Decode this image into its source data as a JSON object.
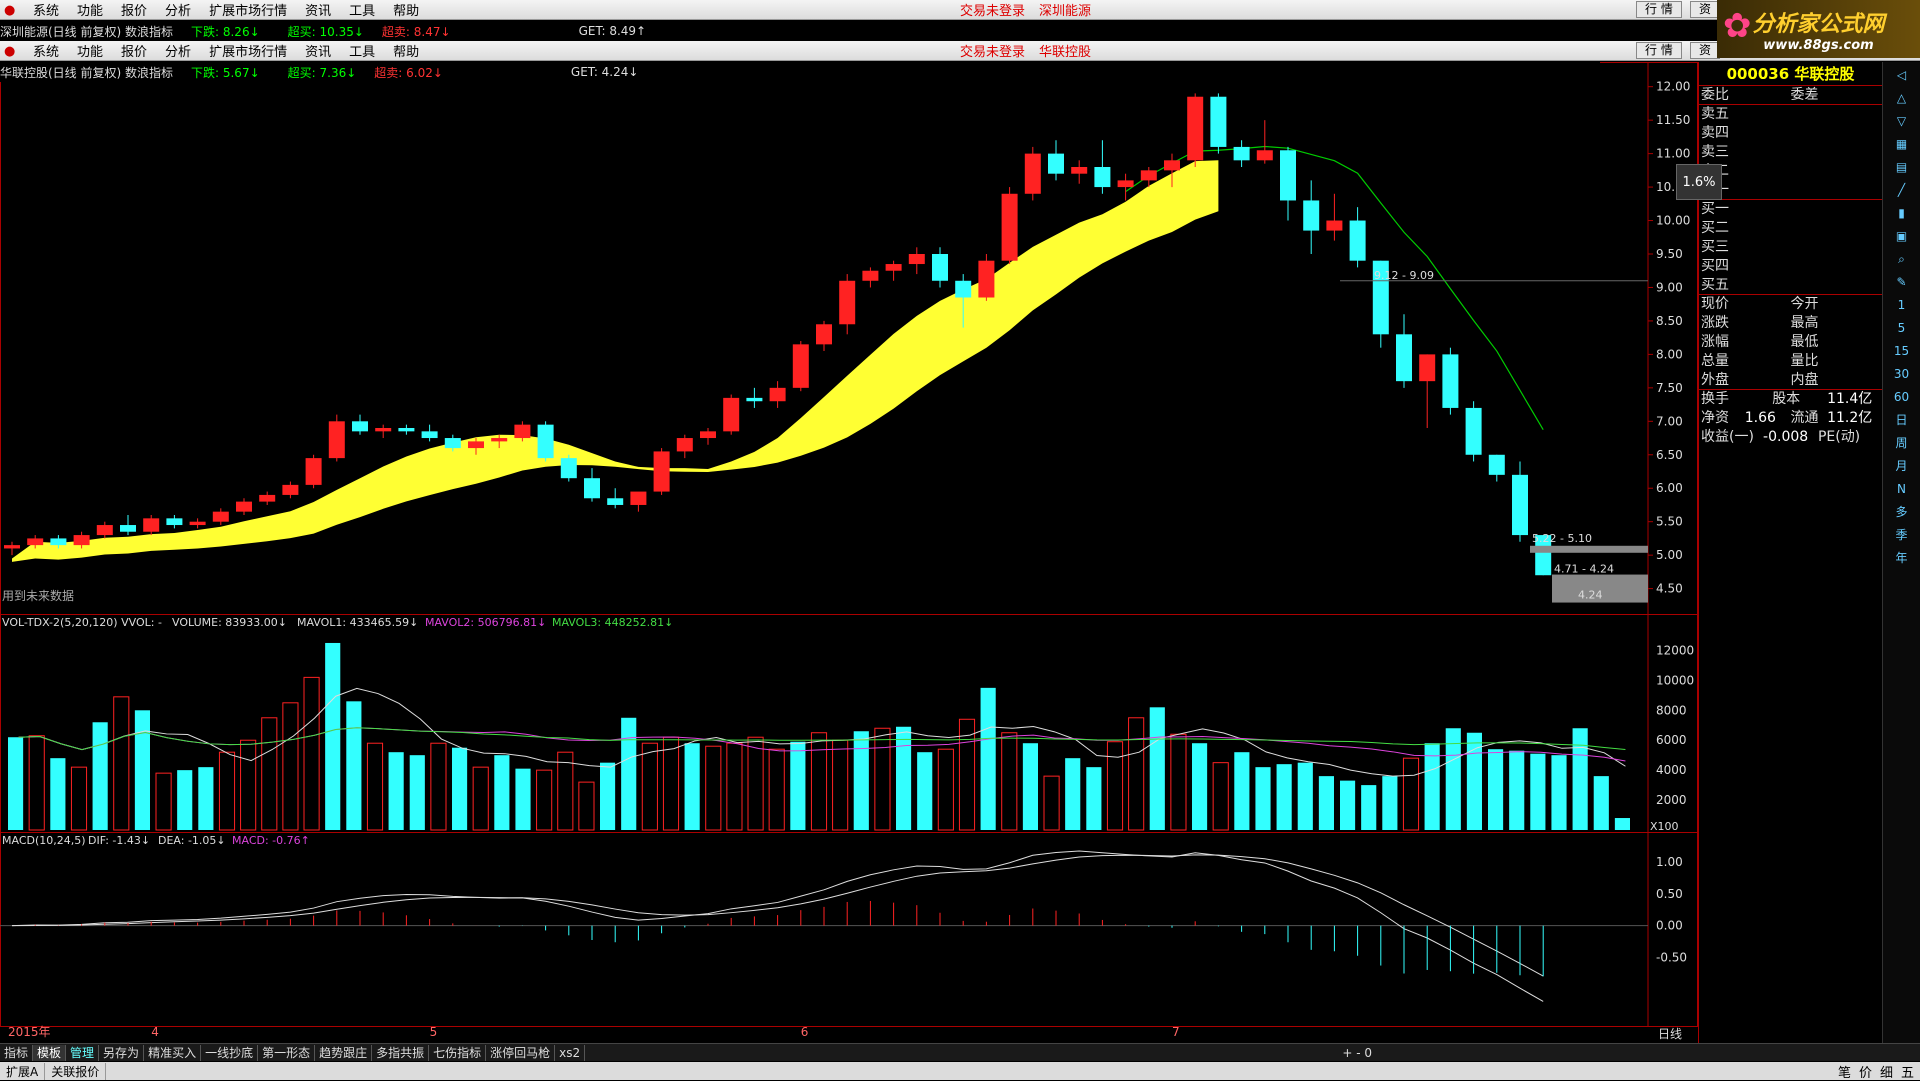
{
  "top_window": {
    "menu": [
      "系统",
      "功能",
      "报价",
      "分析",
      "扩展市场行情",
      "资讯",
      "工具",
      "帮助"
    ],
    "status_text": "交易未登录",
    "stock_name": "深圳能源",
    "buttons": [
      "行 情",
      "资"
    ],
    "info": {
      "title": "深圳能源(日线 前复权) 数浪指标",
      "down": "下跌: 8.26↓",
      "overbuy": "超买: 10.35↓",
      "oversell": "超卖: 8.47↓",
      "get": "GET: 8.49↑"
    }
  },
  "main_window": {
    "menu": [
      "系统",
      "功能",
      "报价",
      "分析",
      "扩展市场行情",
      "资讯",
      "工具",
      "帮助"
    ],
    "status_text": "交易未登录",
    "stock_name": "华联控股",
    "buttons": [
      "行 情",
      "资"
    ],
    "info": {
      "title": "华联控股(日线 前复权) 数浪指标",
      "down": "下跌: 5.67↓",
      "overbuy": "超买: 7.36↓",
      "oversell": "超卖: 6.02↓",
      "get": "GET: 4.24↓"
    }
  },
  "brand": {
    "name": "分析家公式网",
    "url": "www.88gs.com"
  },
  "percent_badge": "1.6%",
  "right_panel": {
    "code_title": "000036 华联控股",
    "order_header": [
      "委比",
      "委差"
    ],
    "sells": [
      "卖五",
      "卖四",
      "卖三",
      "卖二",
      "卖一"
    ],
    "buys": [
      "买一",
      "买二",
      "买三",
      "买四",
      "买五"
    ],
    "quote_rows": [
      [
        "现价",
        "今开"
      ],
      [
        "涨跌",
        "最高"
      ],
      [
        "涨幅",
        "最低"
      ],
      [
        "总量",
        "量比"
      ],
      [
        "外盘",
        "内盘"
      ]
    ],
    "fund_rows": [
      [
        "换手",
        "股本",
        "11.4亿"
      ],
      [
        "净资",
        "1.66",
        "流通",
        "11.2亿"
      ],
      [
        "收益(一)",
        "-0.008",
        "PE(动)"
      ]
    ]
  },
  "chart_labels": {
    "future_data": "用到未来数据",
    "range1": "9.12 - 9.09",
    "range2": "5.22 - 5.10",
    "range3": "4.71 - 4.24",
    "range4": "4.24",
    "vol_legend": "VOL-TDX-2(5,20,120) VVOL: -",
    "vol_volume": "VOLUME: 83933.00↓",
    "vol_mavol1": "MAVOL1: 433465.59↓",
    "vol_mavol2": "MAVOL2: 506796.81↓",
    "vol_mavol3": "MAVOL3: 448252.81↓",
    "vol_unit": "X100",
    "macd_legend": "MACD(10,24,5)",
    "macd_dif": "DIF: -1.43↓",
    "macd_dea": "DEA: -1.05↓",
    "macd_macd": "MACD: -0.76↑",
    "period": "日线"
  },
  "chart_data": {
    "type": "candlestick",
    "price_axis": [
      "12.00",
      "11.50",
      "11.00",
      "10.50",
      "10.00",
      "9.50",
      "9.00",
      "8.50",
      "8.00",
      "7.50",
      "7.00",
      "6.50",
      "6.00",
      "5.50",
      "5.00",
      "4.50"
    ],
    "volume_axis": [
      "12000",
      "10000",
      "8000",
      "6000",
      "4000",
      "2000"
    ],
    "macd_axis": [
      "1.00",
      "0.50",
      "0.00",
      "-0.50"
    ],
    "months": [
      "2015年",
      "4",
      "5",
      "6",
      "7"
    ],
    "candles": [
      [
        5.1,
        5.2,
        5.0,
        5.15
      ],
      [
        5.15,
        5.3,
        5.1,
        5.25
      ],
      [
        5.25,
        5.3,
        5.1,
        5.15
      ],
      [
        5.15,
        5.35,
        5.1,
        5.3
      ],
      [
        5.3,
        5.5,
        5.25,
        5.45
      ],
      [
        5.45,
        5.6,
        5.3,
        5.35
      ],
      [
        5.35,
        5.6,
        5.3,
        5.55
      ],
      [
        5.55,
        5.6,
        5.4,
        5.45
      ],
      [
        5.45,
        5.55,
        5.4,
        5.5
      ],
      [
        5.5,
        5.7,
        5.45,
        5.65
      ],
      [
        5.65,
        5.85,
        5.6,
        5.8
      ],
      [
        5.8,
        5.95,
        5.75,
        5.9
      ],
      [
        5.9,
        6.1,
        5.85,
        6.05
      ],
      [
        6.05,
        6.5,
        6.0,
        6.45
      ],
      [
        6.45,
        7.1,
        6.4,
        7.0
      ],
      [
        7.0,
        7.1,
        6.8,
        6.85
      ],
      [
        6.85,
        6.95,
        6.75,
        6.9
      ],
      [
        6.9,
        6.95,
        6.8,
        6.85
      ],
      [
        6.85,
        6.95,
        6.7,
        6.75
      ],
      [
        6.75,
        6.8,
        6.55,
        6.6
      ],
      [
        6.6,
        6.75,
        6.5,
        6.7
      ],
      [
        6.7,
        6.8,
        6.6,
        6.75
      ],
      [
        6.75,
        7.0,
        6.7,
        6.95
      ],
      [
        6.95,
        7.0,
        6.4,
        6.45
      ],
      [
        6.45,
        6.5,
        6.1,
        6.15
      ],
      [
        6.15,
        6.3,
        5.8,
        5.85
      ],
      [
        5.85,
        6.0,
        5.7,
        5.75
      ],
      [
        5.75,
        5.9,
        5.65,
        5.95
      ],
      [
        5.95,
        6.6,
        5.9,
        6.55
      ],
      [
        6.55,
        6.8,
        6.45,
        6.75
      ],
      [
        6.75,
        6.9,
        6.65,
        6.85
      ],
      [
        6.85,
        7.4,
        6.8,
        7.35
      ],
      [
        7.35,
        7.5,
        7.2,
        7.3
      ],
      [
        7.3,
        7.6,
        7.2,
        7.5
      ],
      [
        7.5,
        8.2,
        7.45,
        8.15
      ],
      [
        8.15,
        8.5,
        8.05,
        8.45
      ],
      [
        8.45,
        9.2,
        8.3,
        9.1
      ],
      [
        9.1,
        9.3,
        9.0,
        9.25
      ],
      [
        9.25,
        9.4,
        9.1,
        9.35
      ],
      [
        9.35,
        9.6,
        9.2,
        9.5
      ],
      [
        9.5,
        9.6,
        9.0,
        9.1
      ],
      [
        9.1,
        9.2,
        8.4,
        8.85
      ],
      [
        8.85,
        9.5,
        8.8,
        9.4
      ],
      [
        9.4,
        10.5,
        9.35,
        10.4
      ],
      [
        10.4,
        11.1,
        10.3,
        11.0
      ],
      [
        11.0,
        11.2,
        10.6,
        10.7
      ],
      [
        10.7,
        10.9,
        10.55,
        10.8
      ],
      [
        10.8,
        11.2,
        10.4,
        10.5
      ],
      [
        10.5,
        10.7,
        10.3,
        10.6
      ],
      [
        10.6,
        10.8,
        10.5,
        10.75
      ],
      [
        10.75,
        11.0,
        10.5,
        10.9
      ],
      [
        10.9,
        11.9,
        10.8,
        11.85
      ],
      [
        11.85,
        11.9,
        11.0,
        11.1
      ],
      [
        11.1,
        11.2,
        10.8,
        10.9
      ],
      [
        10.9,
        11.5,
        10.85,
        11.05
      ],
      [
        11.05,
        11.1,
        10.0,
        10.3
      ],
      [
        10.3,
        10.6,
        9.5,
        9.85
      ],
      [
        9.85,
        10.4,
        9.7,
        10.0
      ],
      [
        10.0,
        10.2,
        9.3,
        9.4
      ],
      [
        9.4,
        9.4,
        8.1,
        8.3
      ],
      [
        8.3,
        8.6,
        7.5,
        7.6
      ],
      [
        7.6,
        8.0,
        6.9,
        8.0
      ],
      [
        8.0,
        8.1,
        7.1,
        7.2
      ],
      [
        7.2,
        7.3,
        6.4,
        6.5
      ],
      [
        6.5,
        6.5,
        6.1,
        6.2
      ],
      [
        6.2,
        6.4,
        5.2,
        5.3
      ],
      [
        5.3,
        5.3,
        4.7,
        4.7
      ]
    ],
    "volumes": [
      6200,
      6300,
      4800,
      4200,
      7200,
      8900,
      8000,
      3800,
      4000,
      4200,
      5200,
      6000,
      7500,
      8500,
      10200,
      12500,
      8600,
      5800,
      5200,
      5000,
      5800,
      5500,
      4200,
      5000,
      4100,
      4000,
      5200,
      3200,
      4500,
      7500,
      5800,
      6200,
      5800,
      5600,
      5800,
      6200,
      5400,
      5900,
      6500,
      6000,
      6600,
      6800,
      6900,
      5200,
      5400,
      7400,
      9500,
      6500,
      5800,
      3600,
      4800,
      4200,
      5900,
      7500,
      8200,
      6400,
      5800,
      4500,
      5200,
      4200,
      4400,
      4500,
      3600,
      3300,
      3000,
      3600,
      4800,
      5800,
      6800,
      6500,
      5400,
      5300,
      5100,
      5000,
      6800,
      3600,
      800
    ],
    "volume_colors": [
      "down",
      "up",
      "down",
      "up",
      "down",
      "up",
      "down",
      "up",
      "down",
      "down",
      "up",
      "up",
      "up",
      "up",
      "up",
      "down",
      "down",
      "up",
      "down",
      "down",
      "up",
      "down",
      "up",
      "down",
      "down",
      "up",
      "up",
      "up",
      "down",
      "down",
      "up",
      "up",
      "down",
      "up",
      "up",
      "up",
      "up",
      "down",
      "up",
      "up",
      "down",
      "up",
      "down",
      "down",
      "up",
      "up",
      "down",
      "up",
      "down",
      "up",
      "down",
      "down",
      "up",
      "up",
      "down",
      "up",
      "down",
      "up",
      "down",
      "down",
      "down",
      "down",
      "down",
      "down",
      "down",
      "down",
      "up",
      "down",
      "down",
      "down",
      "down",
      "down",
      "down",
      "down",
      "down",
      "down",
      "down"
    ]
  },
  "tabs": [
    "指标",
    "模板",
    "管理",
    "另存为",
    "精准买入",
    "一线抄底",
    "第一形态",
    "趋势跟庄",
    "多指共振",
    "七伤指标",
    "涨停回马枪",
    "xs2"
  ],
  "status_items": [
    "扩展A",
    "关联报价"
  ],
  "status_right": [
    "笔",
    "价",
    "细",
    "五"
  ],
  "toolbar_right": [
    "1",
    "5",
    "15",
    "30",
    "60",
    "日",
    "周",
    "月",
    "N",
    "多",
    "季",
    "年"
  ],
  "colors": {
    "up": "#ff2222",
    "down": "#33ffff",
    "ribbon": "#ffff33",
    "ma": "#00cc00",
    "grid_frame": "#aa0000"
  }
}
